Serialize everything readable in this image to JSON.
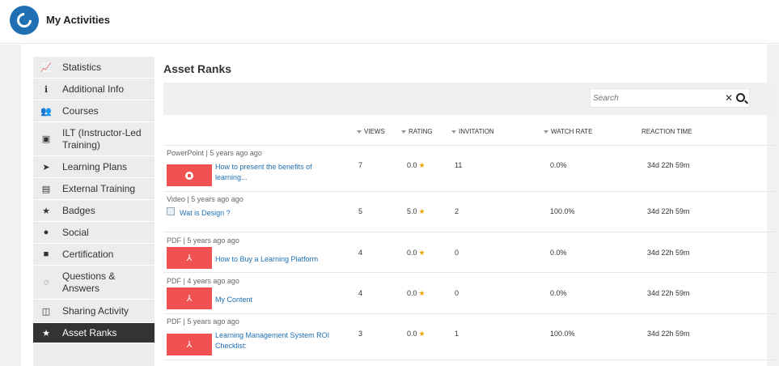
{
  "app": {
    "title": "My Activities"
  },
  "sidebar": {
    "items": [
      {
        "label": "Statistics",
        "icon": "chart-icon",
        "glyph": "📈"
      },
      {
        "label": "Additional Info",
        "icon": "info-icon",
        "glyph": "ℹ"
      },
      {
        "label": "Courses",
        "icon": "courses-icon",
        "glyph": "👥"
      },
      {
        "label": "ILT (Instructor-Led Training)",
        "icon": "ilt-icon",
        "glyph": "▣"
      },
      {
        "label": "Learning Plans",
        "icon": "signpost-icon",
        "glyph": "➤"
      },
      {
        "label": "External Training",
        "icon": "clipboard-icon",
        "glyph": "▤"
      },
      {
        "label": "Badges",
        "icon": "badge-star-icon",
        "glyph": "★"
      },
      {
        "label": "Social",
        "icon": "chat-icon",
        "glyph": "●"
      },
      {
        "label": "Certification",
        "icon": "certificate-icon",
        "glyph": "■"
      },
      {
        "label": "Questions & Answers",
        "icon": "qa-icon",
        "glyph": "◌"
      },
      {
        "label": "Sharing Activity",
        "icon": "share-icon",
        "glyph": "◫"
      },
      {
        "label": "Asset Ranks",
        "icon": "star-icon",
        "glyph": "★"
      }
    ],
    "active_index": 11
  },
  "main": {
    "title": "Asset Ranks",
    "search": {
      "placeholder": "Search",
      "value": ""
    },
    "columns": {
      "views": "VIEWS",
      "rating": "RATING",
      "invitation": "INVITATION",
      "watch_rate": "WATCH RATE",
      "reaction_time": "REACTION TIME"
    },
    "rows": [
      {
        "meta": "PowerPoint | 5 years ago ago",
        "title": "How to present the benefits of learning...",
        "thumb": "ppt",
        "views": "7",
        "rating": "0.0",
        "invitation": "11",
        "watch_rate": "0.0%",
        "reaction_time": "34d 22h 59m"
      },
      {
        "meta": "Video | 5 years ago ago",
        "title": "Wat is Design ?",
        "thumb": "broken",
        "views": "5",
        "rating": "5.0",
        "invitation": "2",
        "watch_rate": "100.0%",
        "reaction_time": "34d 22h 59m"
      },
      {
        "meta": "PDF | 5 years ago ago",
        "title": "How to Buy a Learning Platform",
        "thumb": "pdf",
        "views": "4",
        "rating": "0.0",
        "invitation": "0",
        "watch_rate": "0.0%",
        "reaction_time": "34d 22h 59m"
      },
      {
        "meta": "PDF | 4 years ago ago",
        "title": "My Content",
        "thumb": "pdf",
        "views": "4",
        "rating": "0.0",
        "invitation": "0",
        "watch_rate": "0.0%",
        "reaction_time": "34d 22h 59m"
      },
      {
        "meta": "PDF | 5 years ago ago",
        "title": "Learning Management System ROI Checklist:",
        "thumb": "pdf",
        "views": "3",
        "rating": "0.0",
        "invitation": "1",
        "watch_rate": "100.0%",
        "reaction_time": "34d 22h 59m"
      }
    ]
  },
  "colors": {
    "brand": "#1f6fb2",
    "pdf_thumb": "#f05252",
    "star": "#f0a500",
    "active_item_bg": "#333333"
  }
}
